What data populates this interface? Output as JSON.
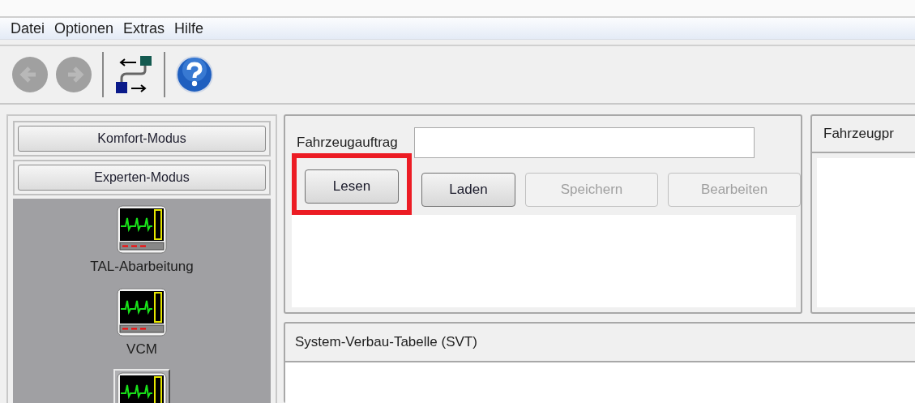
{
  "menu": [
    "Datei",
    "Optionen",
    "Extras",
    "Hilfe"
  ],
  "toolbar": [
    {
      "kind": "back",
      "disabled": true
    },
    {
      "kind": "forward",
      "disabled": true
    },
    {
      "kind": "separator"
    },
    {
      "kind": "route"
    },
    {
      "kind": "separator"
    },
    {
      "kind": "help"
    }
  ],
  "sidebar": {
    "modes": [
      "Komfort-Modus",
      "Experten-Modus"
    ],
    "items": [
      {
        "label": "TAL-Abarbeitung",
        "selected": false
      },
      {
        "label": "VCM",
        "selected": false
      },
      {
        "selected": true
      }
    ]
  },
  "order_panel": {
    "label": "Fahrzeugauftrag",
    "buttons": [
      {
        "label": "Lesen",
        "disabled": false,
        "highlighted": true
      },
      {
        "label": "Laden",
        "disabled": false,
        "highlighted": false
      },
      {
        "label": "Speichern",
        "disabled": true,
        "highlighted": false
      },
      {
        "label": "Bearbeiten",
        "disabled": true,
        "highlighted": false
      }
    ]
  },
  "side_panel": {
    "title": "Fahrzeugpr"
  },
  "svt_panel": {
    "title": "System-Verbau-Tabelle (SVT)"
  }
}
